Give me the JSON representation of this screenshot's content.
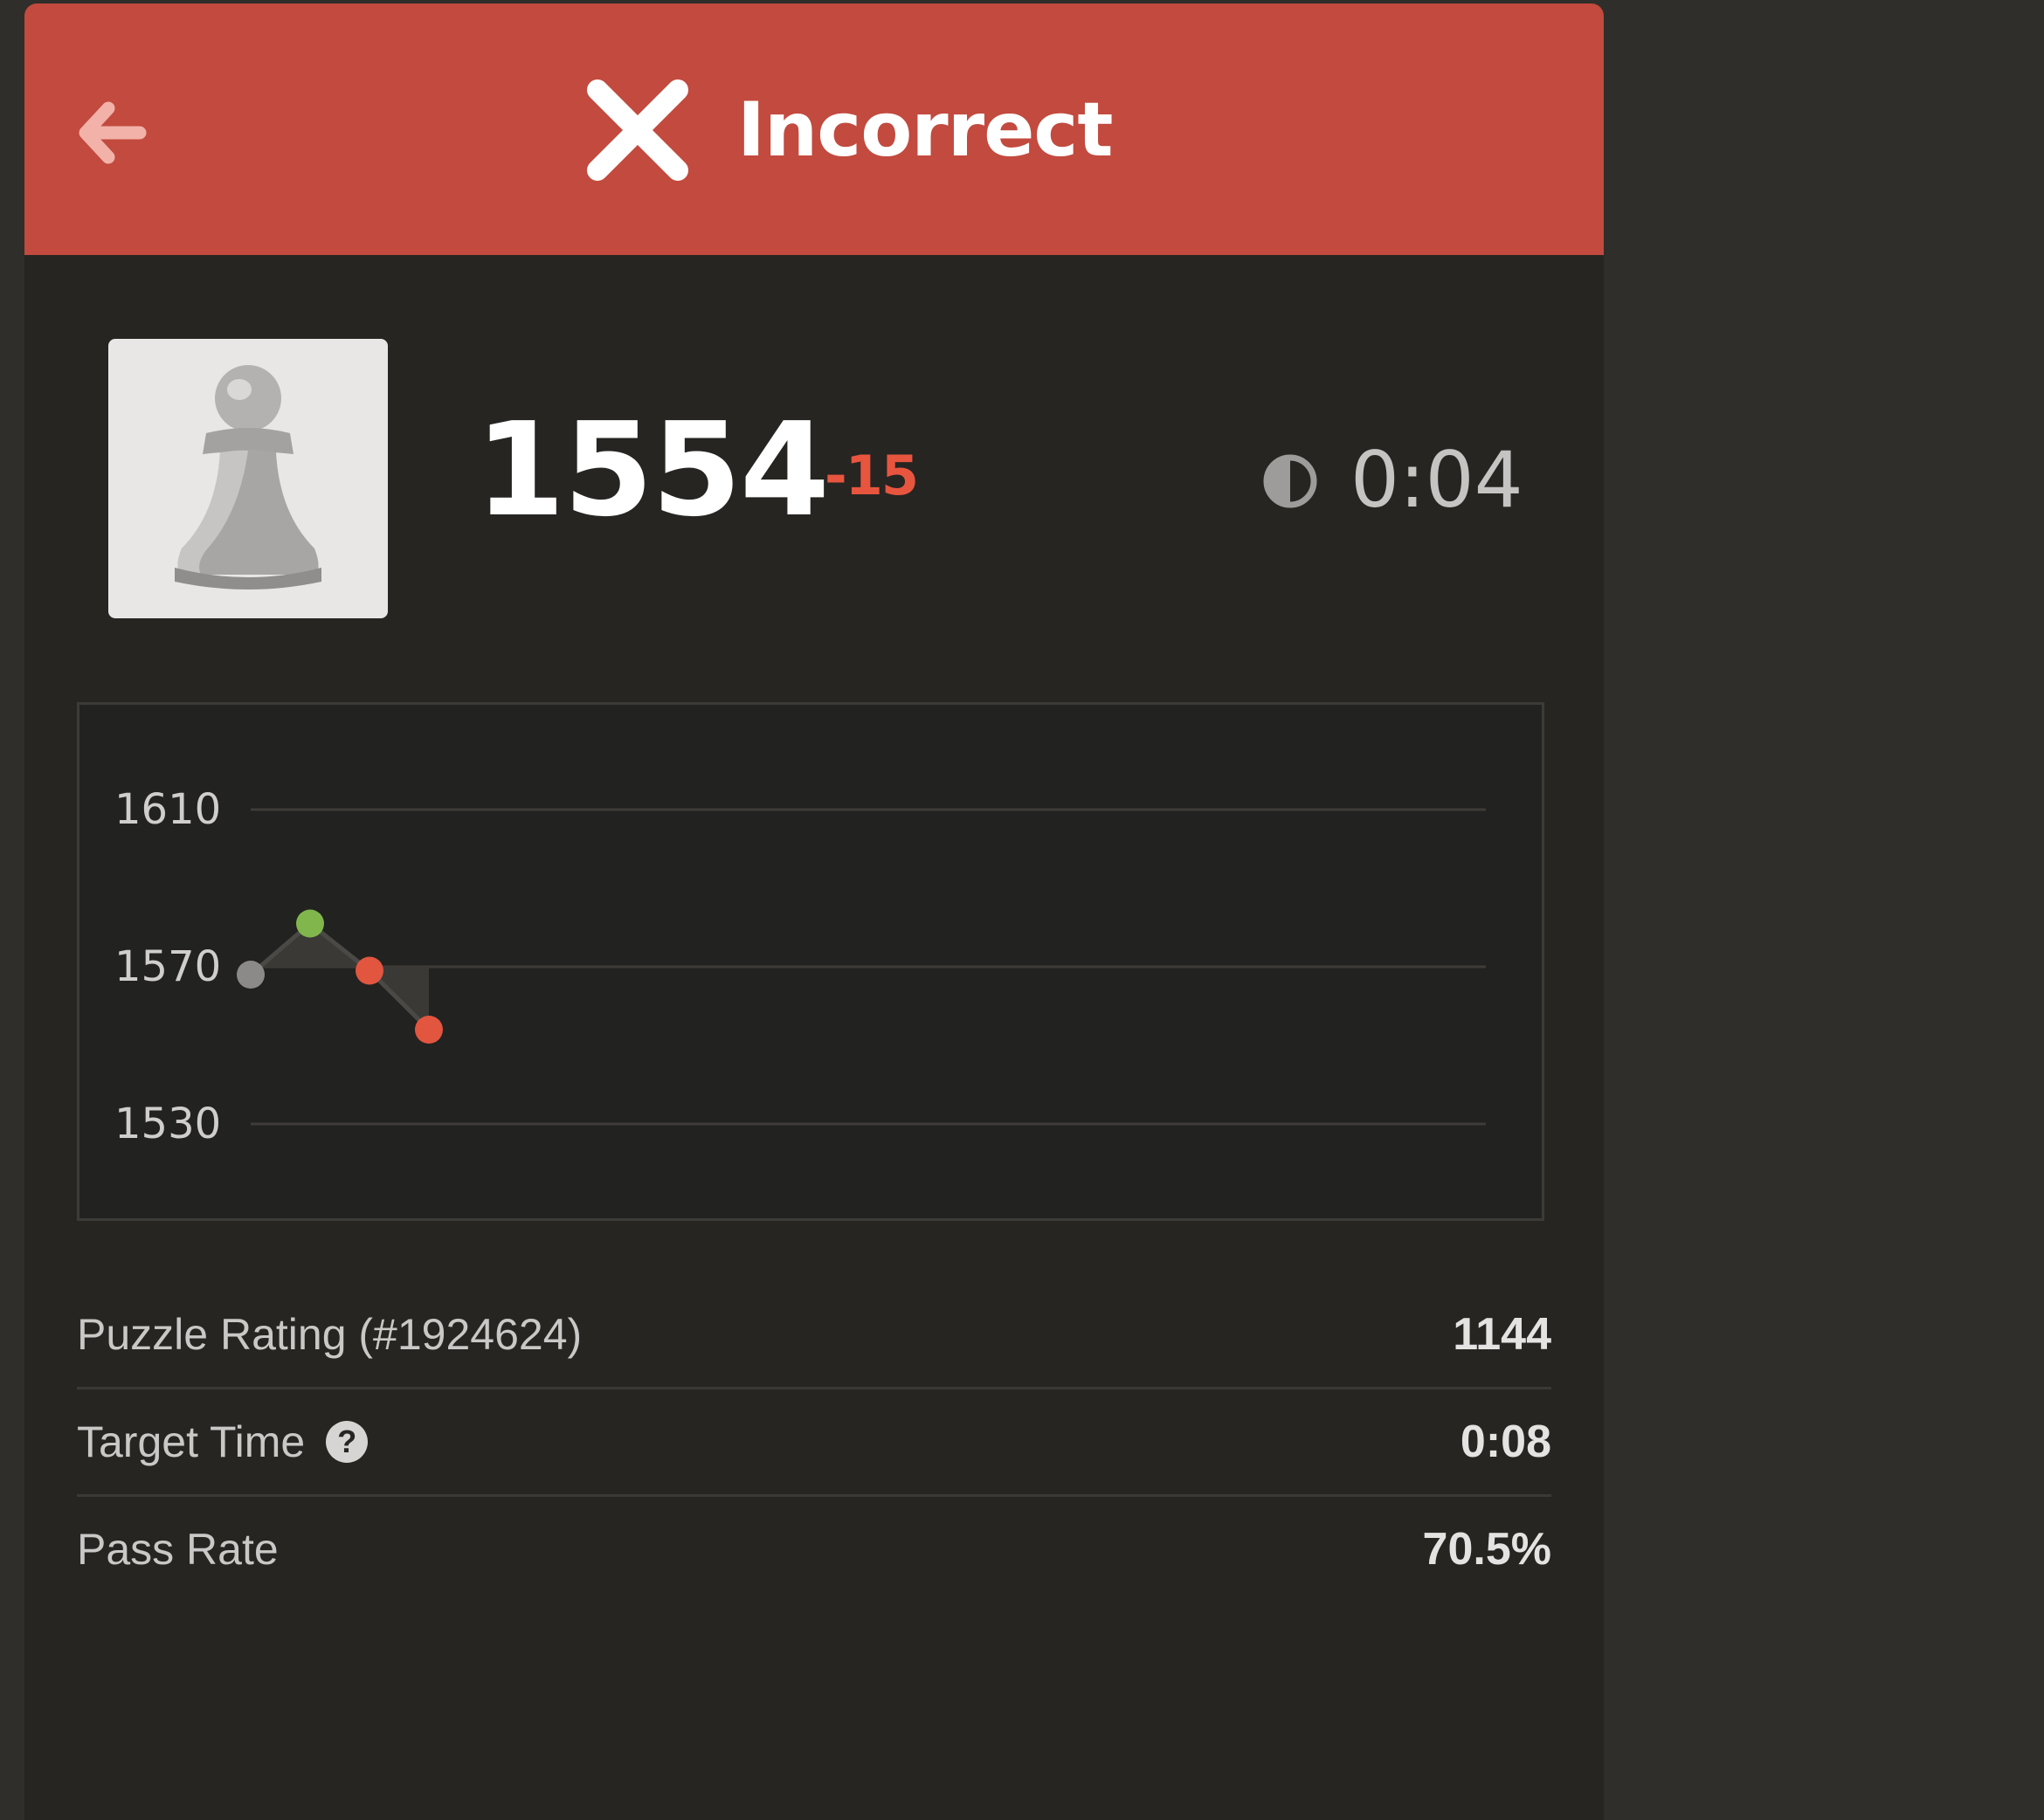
{
  "header": {
    "title": "Incorrect",
    "background_color": "#c24a3e",
    "back_icon": "arrow-left-icon",
    "status_icon": "x-icon"
  },
  "player": {
    "avatar_icon": "pawn-icon",
    "rating": "1554",
    "rating_change": "-15",
    "timer_icon": "half-circle-clock-icon",
    "time": "0:04"
  },
  "chart_data": {
    "type": "line",
    "title": "",
    "xlabel": "",
    "ylabel": "",
    "y_ticks": [
      "1610",
      "1570",
      "1530"
    ],
    "ylim": [
      1530,
      1610
    ],
    "grid": true,
    "x": [
      1,
      2,
      3,
      4
    ],
    "values": [
      1568,
      1581,
      1569,
      1554
    ],
    "point_colors": [
      "#8b8a88",
      "#81b64c",
      "#e2553f",
      "#e2553f"
    ]
  },
  "stats": [
    {
      "label": "Puzzle Rating (#1924624)",
      "value": "1144"
    },
    {
      "label": "Target Time",
      "value": "0:08",
      "help_icon": "question-circle-icon"
    },
    {
      "label": "Pass Rate",
      "value": "70.5%"
    }
  ]
}
